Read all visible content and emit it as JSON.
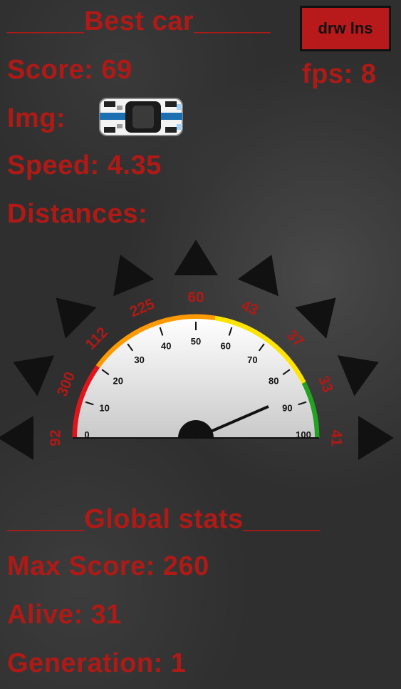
{
  "best_car": {
    "heading": "_____Best car_____",
    "score": "Score: 69",
    "img_label": "Img:",
    "speed": "Speed: 4.35",
    "distances_label": "Distances:"
  },
  "controls": {
    "draw_lines_label": "drw lns",
    "fps": "fps: 8"
  },
  "speedometer": {
    "min": 0,
    "max": 100,
    "value": 87,
    "ticks": [
      "0",
      "10",
      "20",
      "30",
      "40",
      "50",
      "60",
      "70",
      "80",
      "90",
      "100"
    ],
    "colors": {
      "low": "#e0141b",
      "mid": "#ff9900",
      "high": "#ffe400",
      "top": "#22a321"
    }
  },
  "sensors": [
    {
      "label": "92",
      "arrow": "arrow-left-icon"
    },
    {
      "label": "300",
      "arrow": "arrow-down-left-icon"
    },
    {
      "label": "112",
      "arrow": "arrow-up-left-icon"
    },
    {
      "label": "225",
      "arrow": "arrow-up-left-icon"
    },
    {
      "label": "60",
      "arrow": "arrow-up-icon"
    },
    {
      "label": "43",
      "arrow": "arrow-up-right-icon"
    },
    {
      "label": "37",
      "arrow": "arrow-up-right-icon"
    },
    {
      "label": "33",
      "arrow": "arrow-down-right-icon"
    },
    {
      "label": "41",
      "arrow": "arrow-right-icon"
    }
  ],
  "global_stats": {
    "heading": "_____Global stats_____",
    "max_score": "Max Score: 260",
    "alive": "Alive: 31",
    "generation": "Generation: 1"
  }
}
